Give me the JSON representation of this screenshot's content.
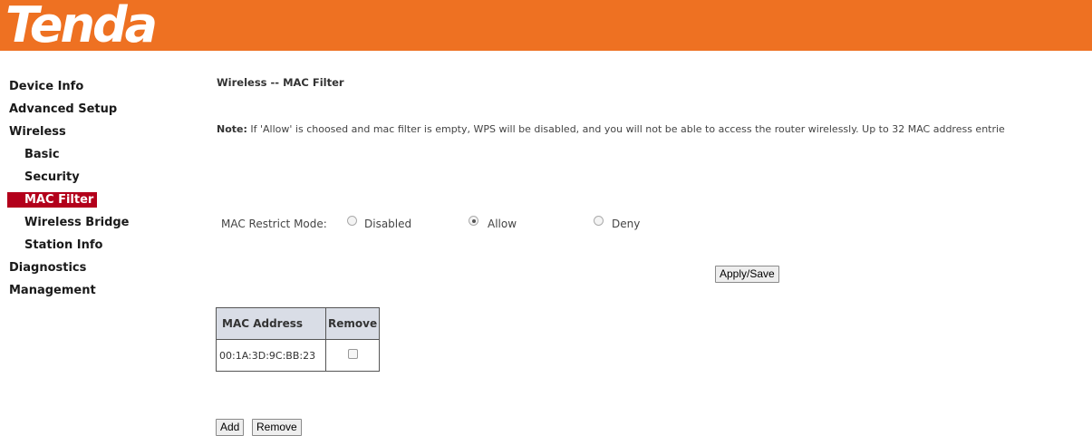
{
  "brand": {
    "logo_text": "Tenda",
    "header_color": "#ee7122"
  },
  "sidebar": {
    "items": [
      {
        "label": "Device Info",
        "level": 0
      },
      {
        "label": "Advanced Setup",
        "level": 0
      },
      {
        "label": "Wireless",
        "level": 0
      },
      {
        "label": "Basic",
        "level": 1
      },
      {
        "label": "Security",
        "level": 1
      },
      {
        "label": "MAC Filter",
        "level": 1,
        "active": true
      },
      {
        "label": "Wireless Bridge",
        "level": 1
      },
      {
        "label": "Station Info",
        "level": 1
      },
      {
        "label": "Diagnostics",
        "level": 0
      },
      {
        "label": "Management",
        "level": 0
      }
    ],
    "active_color": "#b3001b"
  },
  "main": {
    "title": "Wireless -- MAC Filter",
    "note_label": "Note:",
    "note_text": " If 'Allow' is choosed and mac filter is empty, WPS will be disabled, and you will not be able to access the router wirelessly. Up to 32 MAC address entrie",
    "mode_label": "MAC Restrict Mode:",
    "mode_options": [
      {
        "label": "Disabled",
        "checked": false
      },
      {
        "label": "Allow",
        "checked": true
      },
      {
        "label": "Deny",
        "checked": false
      }
    ],
    "apply_label": "Apply/Save",
    "table": {
      "headers": [
        "MAC Address",
        "Remove"
      ],
      "rows": [
        {
          "mac": "00:1A:3D:9C:BB:23",
          "remove": false
        }
      ]
    },
    "add_label": "Add",
    "remove_label": "Remove"
  }
}
